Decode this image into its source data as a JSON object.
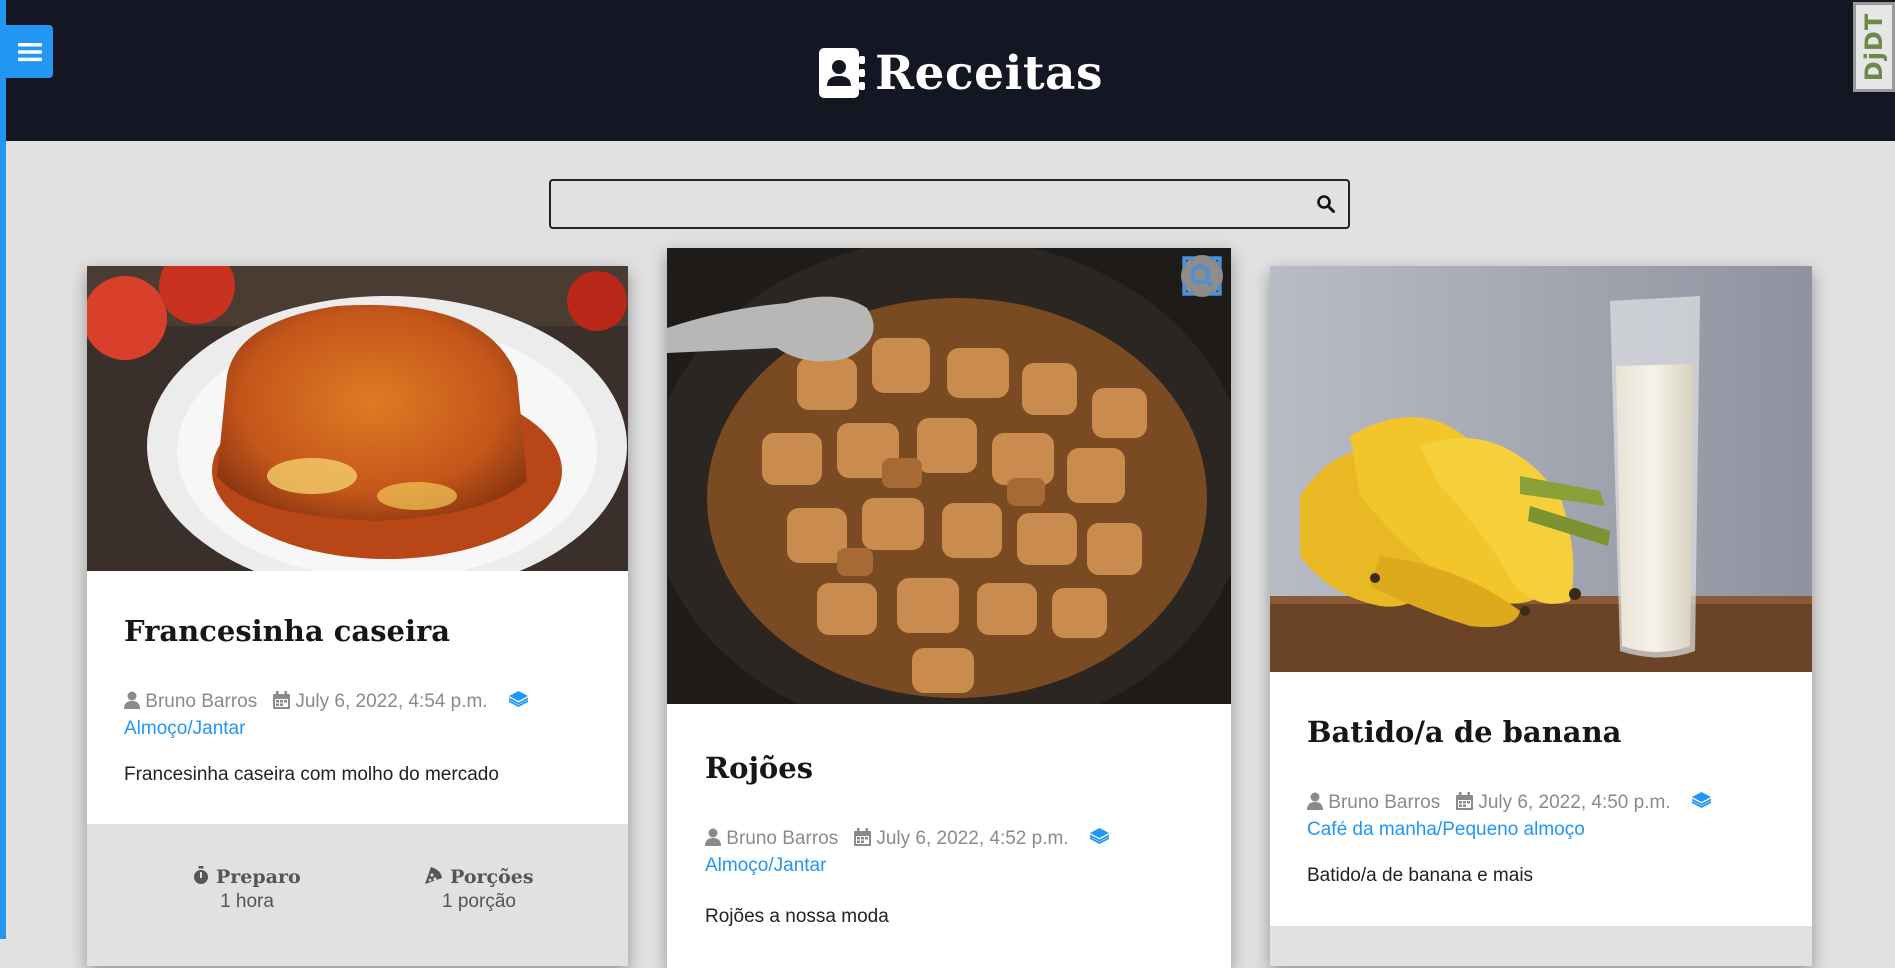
{
  "app": {
    "title": "Receitas",
    "debug_toolbar_label": "DjDT"
  },
  "search": {
    "value": "",
    "placeholder": ""
  },
  "colors": {
    "accent": "#2196f3",
    "header_bg": "#141624",
    "page_bg": "#e1e1e1"
  },
  "icons": {
    "menu": "bars-icon",
    "brand": "address-book-icon",
    "search": "search-icon",
    "author": "user-icon",
    "date": "calendar-icon",
    "category": "layers-icon",
    "prep": "stopwatch-icon",
    "servings": "pizza-slice-icon",
    "zoom": "zoom-scan-icon"
  },
  "recipes": [
    {
      "title": "Francesinha caseira",
      "author": "Bruno Barros",
      "date": "July 6, 2022, 4:54 p.m.",
      "category": "Almoço/Jantar",
      "description": "Francesinha caseira com molho do mercado",
      "prep_label": "Preparo",
      "prep_value": "1 hora",
      "servings_label": "Porções",
      "servings_value": "1 porção",
      "image": "francesinha-photo"
    },
    {
      "title": "Rojões",
      "author": "Bruno Barros",
      "date": "July 6, 2022, 4:52 p.m.",
      "category": "Almoço/Jantar",
      "description": "Rojões a nossa moda",
      "image": "rojoes-photo"
    },
    {
      "title": "Batido/a de banana",
      "author": "Bruno Barros",
      "date": "July 6, 2022, 4:50 p.m.",
      "category": "Café da manha/Pequeno almoço",
      "description": "Batido/a de banana e mais",
      "image": "banana-shake-photo"
    }
  ]
}
